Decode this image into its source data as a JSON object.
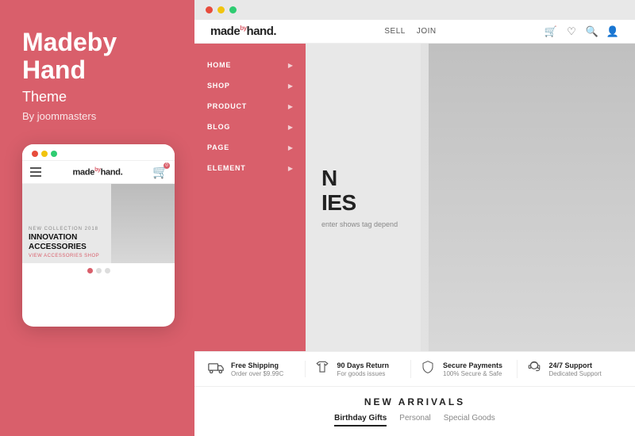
{
  "left": {
    "title": "Madeby Hand",
    "subtitle": "Theme",
    "by": "By joommasters",
    "phone": {
      "logo": "made",
      "logo_sup": "by",
      "logo_end": "hand.",
      "nav_label": "≡",
      "new_collection": "NEW COLLECTION 2018",
      "headline1": "INNOVATION",
      "headline2": "ACCESSORIES",
      "cta": "VIEW ACCESSORIES SHOP",
      "dots": [
        "active",
        "inactive",
        "inactive"
      ]
    }
  },
  "browser": {
    "dots": [
      "red",
      "yellow",
      "green"
    ]
  },
  "site": {
    "logo_start": "made",
    "logo_sup": "by",
    "logo_end": "hand.",
    "nav": [
      {
        "label": "SELL"
      },
      {
        "label": "JOIN"
      }
    ],
    "menu": [
      {
        "label": "HOME"
      },
      {
        "label": "SHOP"
      },
      {
        "label": "PRODUCT"
      },
      {
        "label": "BLOG"
      },
      {
        "label": "PAGE"
      },
      {
        "label": "ELEMENT"
      }
    ],
    "hero": {
      "line1": "N",
      "line2": "IES",
      "subtext": "enter shows tag depend"
    },
    "features": [
      {
        "icon": "truck",
        "title": "Free Shipping",
        "desc": "Order over $9.99C"
      },
      {
        "icon": "shirt",
        "title": "90 Days Return",
        "desc": "For goods issues"
      },
      {
        "icon": "shield",
        "title": "Secure Payments",
        "desc": "100% Secure & Safe"
      },
      {
        "icon": "headset",
        "title": "24/7 Support",
        "desc": "Dedicated Support"
      }
    ],
    "new_arrivals": {
      "title": "NEW ARRIVALS",
      "tabs": [
        {
          "label": "Birthday Gifts",
          "active": true
        },
        {
          "label": "Personal",
          "active": false
        },
        {
          "label": "Special Goods",
          "active": false
        }
      ]
    }
  }
}
